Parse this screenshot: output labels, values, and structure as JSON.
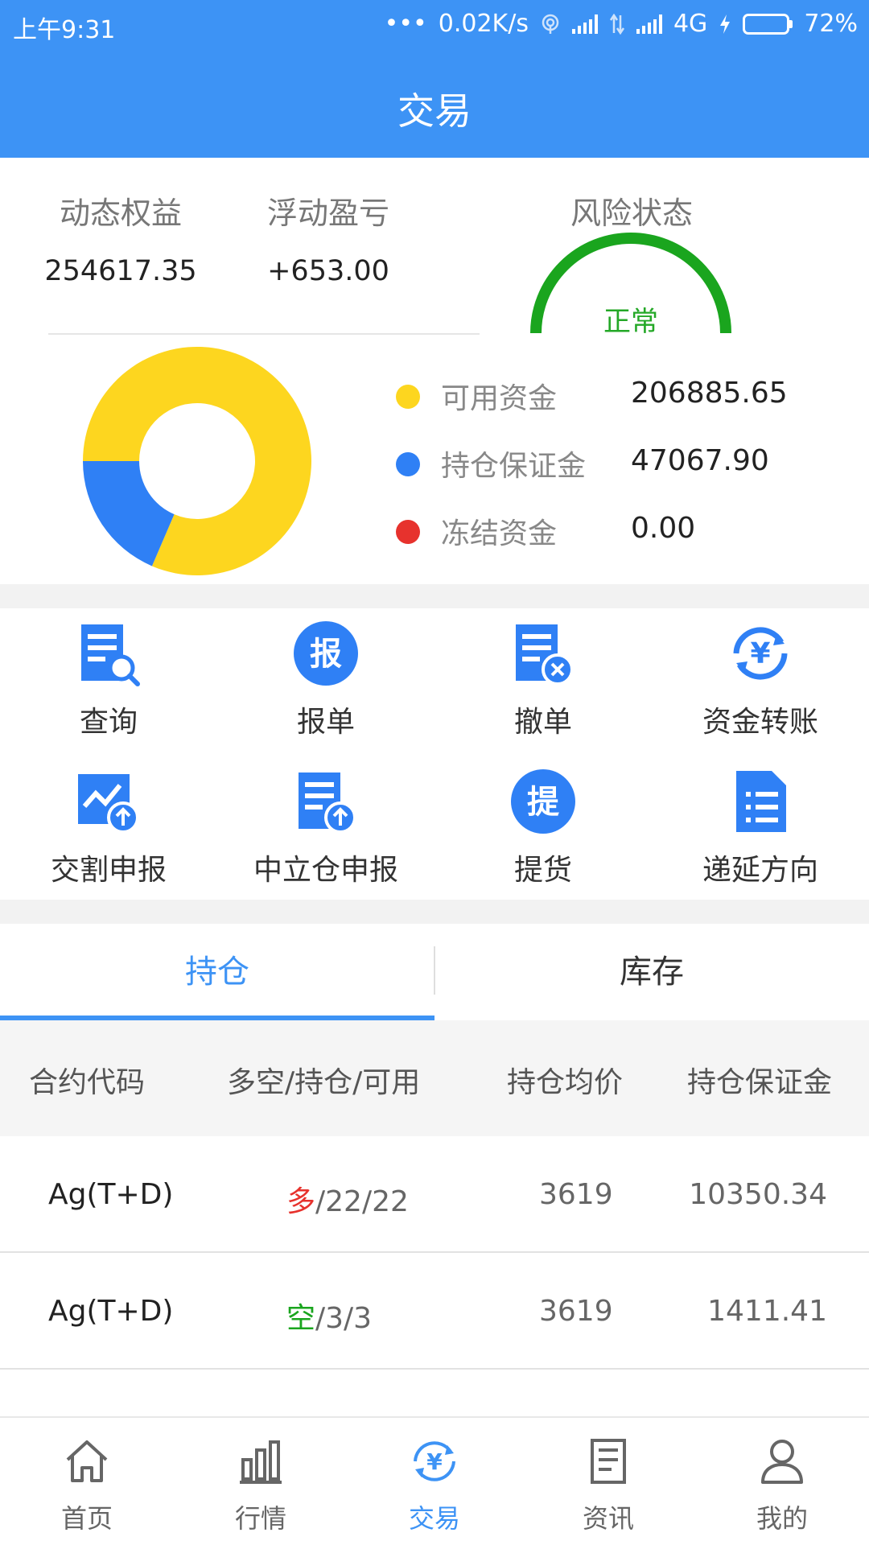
{
  "status": {
    "time": "上午9:31",
    "dots": "•••",
    "speed": "0.02K/s",
    "network": "4G",
    "battery": "72%",
    "battery_level": 0.72
  },
  "header": {
    "title": "交易"
  },
  "summary": {
    "dynamic_equity": {
      "label": "动态权益",
      "value": "254617.35"
    },
    "floating_pl": {
      "label": "浮动盈亏",
      "value": "+653.00"
    },
    "risk": {
      "label": "风险状态",
      "state": "正常",
      "color": "#1aa51e"
    }
  },
  "funds": {
    "items": [
      {
        "name": "可用资金",
        "amount": "206885.65",
        "value": 206885.65,
        "color": "#fdd61f"
      },
      {
        "name": "持仓保证金",
        "amount": "47067.90",
        "value": 47067.9,
        "color": "#2f80f5"
      },
      {
        "name": "冻结资金",
        "amount": "0.00",
        "value": 0.0,
        "color": "#e7322d"
      }
    ]
  },
  "functions": [
    {
      "label": "查询",
      "icon": "query-doc-icon"
    },
    {
      "label": "报单",
      "icon": "order-badge-icon",
      "glyph": "报"
    },
    {
      "label": "撤单",
      "icon": "cancel-doc-icon"
    },
    {
      "label": "资金转账",
      "icon": "yuan-transfer-icon",
      "glyph": "¥"
    },
    {
      "label": "交割申报",
      "icon": "delivery-chart-icon"
    },
    {
      "label": "中立仓申报",
      "icon": "neutral-doc-icon"
    },
    {
      "label": "提货",
      "icon": "pickup-badge-icon",
      "glyph": "提"
    },
    {
      "label": "递延方向",
      "icon": "deferred-list-icon"
    }
  ],
  "tabs": [
    {
      "label": "持仓",
      "active": true
    },
    {
      "label": "库存",
      "active": false
    }
  ],
  "table": {
    "headers": [
      "合约代码",
      "多空/持仓/可用",
      "持仓均价",
      "持仓保证金"
    ],
    "rows": [
      {
        "code": "Ag(T+D)",
        "side": "多",
        "side_color": "#e7322d",
        "qty": "/22/22",
        "avg": "3619",
        "margin": "10350.34"
      },
      {
        "code": "Ag(T+D)",
        "side": "空",
        "side_color": "#1aa51e",
        "qty": "/3/3",
        "avg": "3619",
        "margin": "1411.41"
      }
    ]
  },
  "nav": [
    {
      "label": "首页",
      "icon": "home-icon",
      "active": false
    },
    {
      "label": "行情",
      "icon": "bar-chart-icon",
      "active": false
    },
    {
      "label": "交易",
      "icon": "yuan-exchange-icon",
      "active": true,
      "glyph": "¥"
    },
    {
      "label": "资讯",
      "icon": "news-icon",
      "active": false
    },
    {
      "label": "我的",
      "icon": "user-icon",
      "active": false
    }
  ],
  "colors": {
    "primary": "#3d93f5",
    "icon_blue": "#2f80f5"
  }
}
